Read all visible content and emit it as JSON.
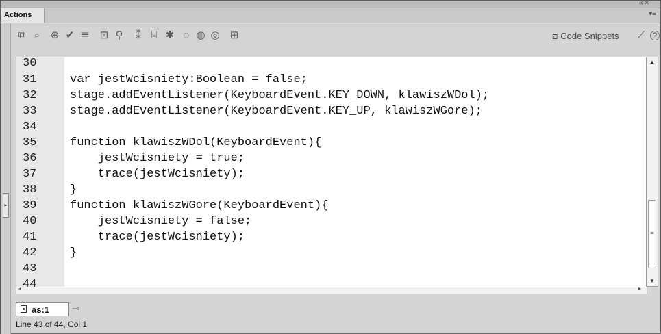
{
  "panel": {
    "title": "Actions",
    "top_controls": "« ×",
    "menu_glyph": "▾≡"
  },
  "toolbar": {
    "icons": [
      {
        "name": "add-new-item-icon",
        "glyph": "⧉"
      },
      {
        "name": "find-icon",
        "glyph": "⌕"
      },
      {
        "name": "insert-target-path-icon",
        "glyph": "⊕"
      },
      {
        "name": "check-syntax-icon",
        "glyph": "✔"
      },
      {
        "name": "auto-format-icon",
        "glyph": "≣"
      },
      {
        "name": "show-code-hint-icon",
        "glyph": "⊡"
      },
      {
        "name": "debug-options-icon",
        "glyph": "⚲"
      },
      {
        "name": "collapse-between-braces-icon",
        "glyph": "⁑"
      },
      {
        "name": "collapse-selection-icon",
        "glyph": "⌸"
      },
      {
        "name": "expand-all-icon",
        "glyph": "✱"
      },
      {
        "name": "apply-block-comment-icon",
        "glyph": "◌"
      },
      {
        "name": "apply-line-comment-icon",
        "glyph": "◍"
      },
      {
        "name": "remove-comment-icon",
        "glyph": "◎"
      },
      {
        "name": "show-hide-toolbox-icon",
        "glyph": "⊞"
      }
    ],
    "code_snippets_label": "Code Snippets",
    "code_snippets_icon": "⧈",
    "wand_icon": "⟋",
    "help_icon": "?"
  },
  "editor": {
    "line_numbers": [
      "30",
      "31",
      "32",
      "33",
      "34",
      "35",
      "36",
      "37",
      "38",
      "39",
      "40",
      "41",
      "42",
      "43",
      "44"
    ],
    "lines": [
      "",
      "var jestWcisniety:Boolean = false;",
      "stage.addEventListener(KeyboardEvent.KEY_DOWN, klawiszWDol);",
      "stage.addEventListener(KeyboardEvent.KEY_UP, klawiszWGore);",
      "",
      "function klawiszWDol(KeyboardEvent){",
      "    jestWcisniety = true;",
      "    trace(jestWcisniety);",
      "}",
      "function klawiszWGore(KeyboardEvent){",
      "    jestWcisniety = false;",
      "    trace(jestWcisniety);",
      "}",
      "",
      ""
    ]
  },
  "filetab": {
    "label": "as:1",
    "pin_glyph": "⊸"
  },
  "status": {
    "text": "Line 43 of 44, Col 1"
  },
  "colors": {
    "panel_bg": "#d4d4d4",
    "gutter_bg": "#e8e8e8",
    "editor_bg": "#ffffff"
  }
}
